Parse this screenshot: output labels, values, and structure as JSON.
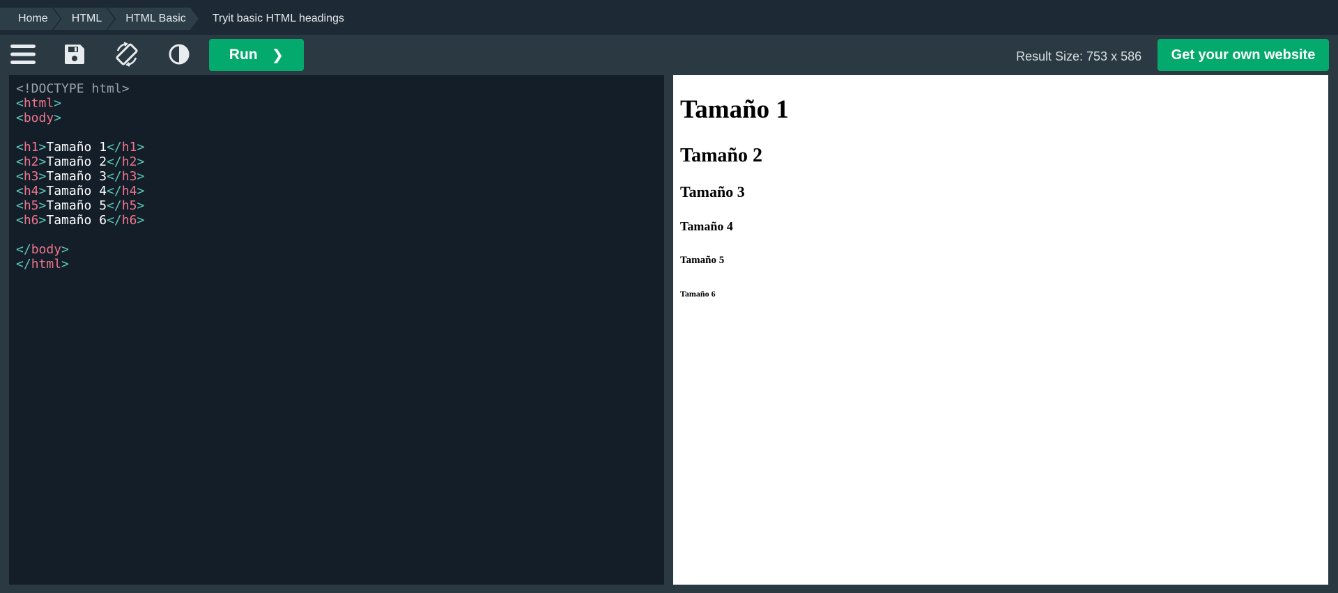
{
  "breadcrumb": {
    "items": [
      {
        "label": "Home"
      },
      {
        "label": "HTML"
      },
      {
        "label": "HTML Basic"
      }
    ],
    "current": "Tryit basic HTML headings"
  },
  "toolbar": {
    "icons": [
      "menu-icon",
      "save-icon",
      "rotate-icon",
      "contrast-icon"
    ],
    "run_label": "Run",
    "run_arrow": "❯",
    "result_size": "Result Size: 753 x 586",
    "get_website_label": "Get your own website"
  },
  "editor": {
    "lines": [
      [
        {
          "t": "<!DOCTYPE html>",
          "c": "c-gray"
        }
      ],
      [
        {
          "t": "<",
          "c": "c-br"
        },
        {
          "t": "html",
          "c": "c-tag"
        },
        {
          "t": ">",
          "c": "c-br"
        }
      ],
      [
        {
          "t": "<",
          "c": "c-br"
        },
        {
          "t": "body",
          "c": "c-tag"
        },
        {
          "t": ">",
          "c": "c-br"
        }
      ],
      [],
      [
        {
          "t": "<",
          "c": "c-br"
        },
        {
          "t": "h1",
          "c": "c-tag"
        },
        {
          "t": ">",
          "c": "c-br"
        },
        {
          "t": "Tamaño 1",
          "c": "c-txt"
        },
        {
          "t": "</",
          "c": "c-br"
        },
        {
          "t": "h1",
          "c": "c-tag"
        },
        {
          "t": ">",
          "c": "c-br"
        }
      ],
      [
        {
          "t": "<",
          "c": "c-br"
        },
        {
          "t": "h2",
          "c": "c-tag"
        },
        {
          "t": ">",
          "c": "c-br"
        },
        {
          "t": "Tamaño 2",
          "c": "c-txt"
        },
        {
          "t": "</",
          "c": "c-br"
        },
        {
          "t": "h2",
          "c": "c-tag"
        },
        {
          "t": ">",
          "c": "c-br"
        }
      ],
      [
        {
          "t": "<",
          "c": "c-br"
        },
        {
          "t": "h3",
          "c": "c-tag"
        },
        {
          "t": ">",
          "c": "c-br"
        },
        {
          "t": "Tamaño 3",
          "c": "c-txt"
        },
        {
          "t": "</",
          "c": "c-br"
        },
        {
          "t": "h3",
          "c": "c-tag"
        },
        {
          "t": ">",
          "c": "c-br"
        }
      ],
      [
        {
          "t": "<",
          "c": "c-br"
        },
        {
          "t": "h4",
          "c": "c-tag"
        },
        {
          "t": ">",
          "c": "c-br"
        },
        {
          "t": "Tamaño 4",
          "c": "c-txt"
        },
        {
          "t": "</",
          "c": "c-br"
        },
        {
          "t": "h4",
          "c": "c-tag"
        },
        {
          "t": ">",
          "c": "c-br"
        }
      ],
      [
        {
          "t": "<",
          "c": "c-br"
        },
        {
          "t": "h5",
          "c": "c-tag"
        },
        {
          "t": ">",
          "c": "c-br"
        },
        {
          "t": "Tamaño 5",
          "c": "c-txt"
        },
        {
          "t": "</",
          "c": "c-br"
        },
        {
          "t": "h5",
          "c": "c-tag"
        },
        {
          "t": ">",
          "c": "c-br"
        }
      ],
      [
        {
          "t": "<",
          "c": "c-br"
        },
        {
          "t": "h6",
          "c": "c-tag"
        },
        {
          "t": ">",
          "c": "c-br"
        },
        {
          "t": "Tamaño 6",
          "c": "c-txt"
        },
        {
          "t": "</",
          "c": "c-br"
        },
        {
          "t": "h6",
          "c": "c-tag"
        },
        {
          "t": ">",
          "c": "c-br"
        }
      ],
      [],
      [
        {
          "t": "</",
          "c": "c-br"
        },
        {
          "t": "body",
          "c": "c-tag"
        },
        {
          "t": ">",
          "c": "c-br"
        }
      ],
      [
        {
          "t": "</",
          "c": "c-br"
        },
        {
          "t": "html",
          "c": "c-tag"
        },
        {
          "t": ">",
          "c": "c-br"
        }
      ]
    ]
  },
  "result": {
    "h1": "Tamaño 1",
    "h2": "Tamaño 2",
    "h3": "Tamaño 3",
    "h4": "Tamaño 4",
    "h5": "Tamaño 5",
    "h6": "Tamaño 6"
  },
  "colors": {
    "accent_green": "#04aa6d",
    "breadcrumb_bg": "#1d2a35",
    "toolbar_bg": "#2b3a42",
    "editor_bg": "#131e29",
    "tag_color": "#f0758c",
    "bracket_color": "#5fc8b8"
  }
}
